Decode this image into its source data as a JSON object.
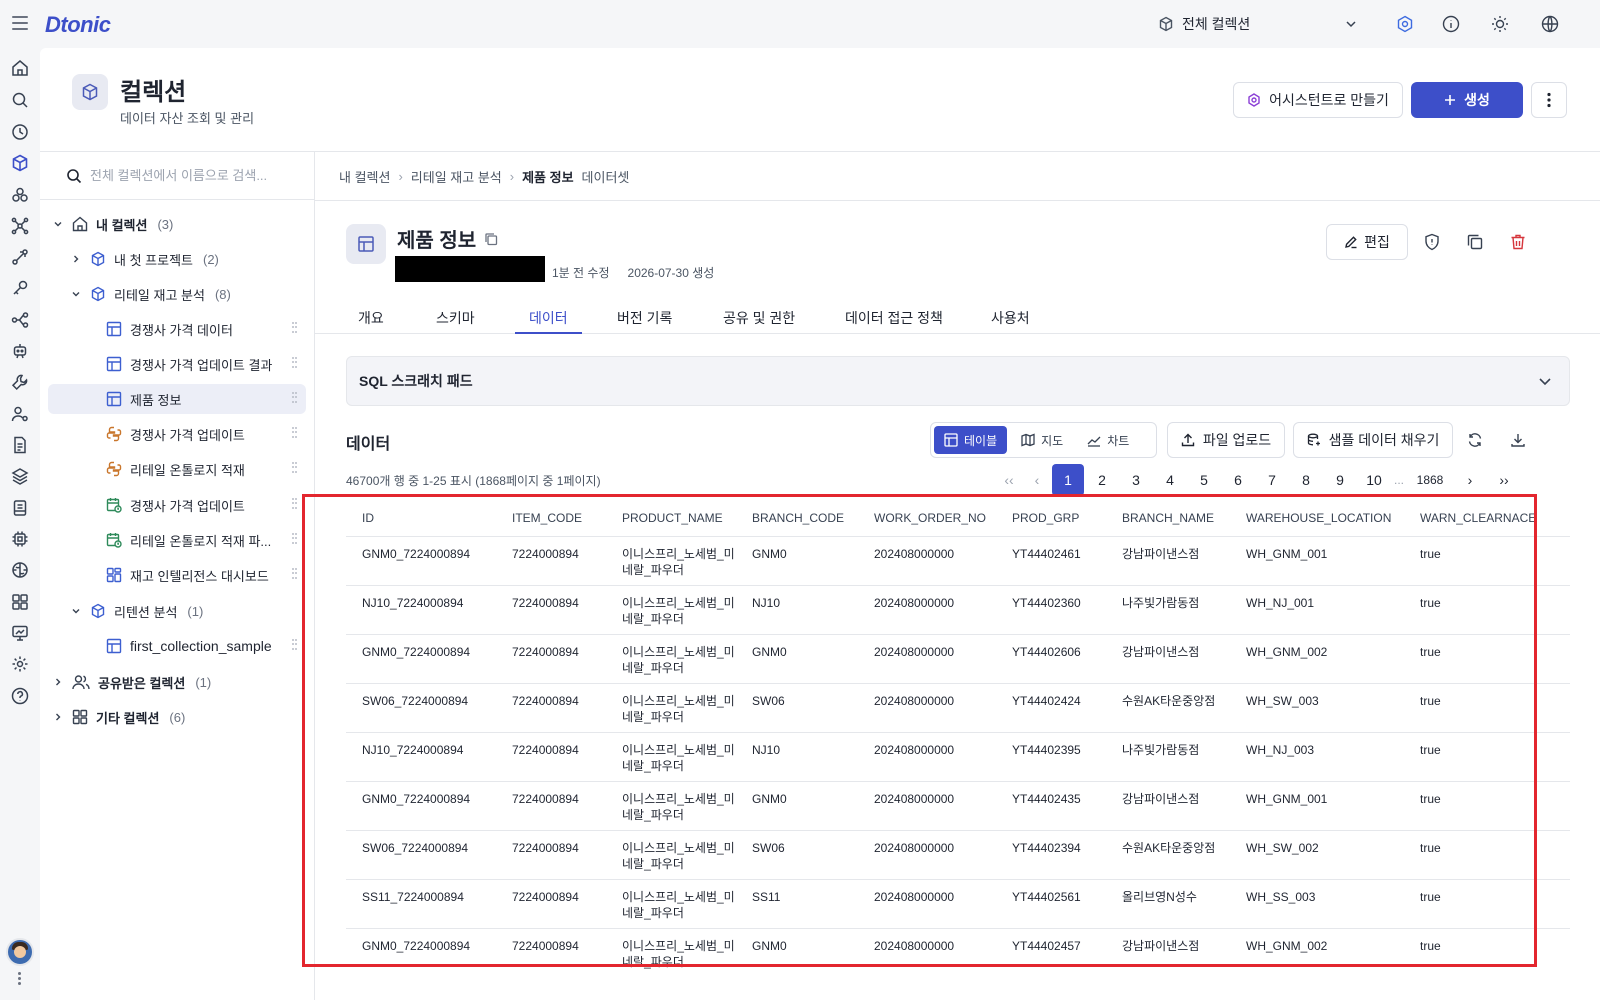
{
  "app": {
    "logo": "Dtonic"
  },
  "topbar": {
    "collection_select": "전체 컬렉션"
  },
  "header": {
    "title": "컬렉션",
    "subtitle": "데이터 자산 조회 및 관리",
    "assist_button": "어시스턴트로 만들기",
    "create_button": "생성"
  },
  "sidebar": {
    "search_placeholder": "전체 컬렉션에서 이름으로 검색...",
    "items": [
      {
        "label": "내 컬렉션",
        "count": "(3)"
      },
      {
        "label": "내 첫 프로젝트",
        "count": "(2)"
      },
      {
        "label": "리테일 재고 분석",
        "count": "(8)"
      },
      {
        "label": "경쟁사 가격 데이터"
      },
      {
        "label": "경쟁사 가격 업데이트 결과"
      },
      {
        "label": "제품 정보"
      },
      {
        "label": "경쟁사 가격 업데이트"
      },
      {
        "label": "리테일 온톨로지 적재"
      },
      {
        "label": "경쟁사 가격 업데이트"
      },
      {
        "label": "리테일 온톨로지 적재 파..."
      },
      {
        "label": "재고 인텔리전스 대시보드"
      },
      {
        "label": "리텐션 분석",
        "count": "(1)"
      },
      {
        "label": "first_collection_sample"
      },
      {
        "label": "공유받은 컬렉션",
        "count": "(1)"
      },
      {
        "label": "기타 컬렉션",
        "count": "(6)"
      }
    ]
  },
  "breadcrumb": {
    "items": [
      "내 컬렉션",
      "리테일 재고 분석",
      "제품 정보"
    ],
    "suffix": "데이터셋"
  },
  "dataset": {
    "title": "제품 정보",
    "modified": "1분 전 수정",
    "created": "2026-07-30 생성",
    "edit_button": "편집"
  },
  "tabs": [
    "개요",
    "스키마",
    "데이터",
    "버전 기록",
    "공유 및 권한",
    "데이터 접근 정책",
    "사용처"
  ],
  "sql_pad": {
    "label": "SQL 스크래치 패드"
  },
  "data_section": {
    "title": "데이터",
    "views": [
      "테이블",
      "지도",
      "차트"
    ],
    "upload_button": "파일 업로드",
    "sample_button": "샘플 데이터 채우기",
    "rows_info": "46700개 행 중 1-25 표시 (1868페이지 중 1페이지)"
  },
  "pagination": {
    "pages": [
      "1",
      "2",
      "3",
      "4",
      "5",
      "6",
      "7",
      "8",
      "9",
      "10"
    ],
    "ellipsis": "...",
    "last": "1868",
    "current": "1"
  },
  "table": {
    "columns": [
      "ID",
      "ITEM_CODE",
      "PRODUCT_NAME",
      "BRANCH_CODE",
      "WORK_ORDER_NO",
      "PROD_GRP",
      "BRANCH_NAME",
      "WAREHOUSE_LOCATION",
      "WARN_CLEARNACE"
    ],
    "rows": [
      [
        "GNM0_7224000894",
        "7224000894",
        "이니스프리_노세범_미네랄_파우더",
        "GNM0",
        "202408000000",
        "YT44402461",
        "강남파이낸스점",
        "WH_GNM_001",
        "true"
      ],
      [
        "NJ10_7224000894",
        "7224000894",
        "이니스프리_노세범_미네랄_파우더",
        "NJ10",
        "202408000000",
        "YT44402360",
        "나주빛가람동점",
        "WH_NJ_001",
        "true"
      ],
      [
        "GNM0_7224000894",
        "7224000894",
        "이니스프리_노세범_미네랄_파우더",
        "GNM0",
        "202408000000",
        "YT44402606",
        "강남파이낸스점",
        "WH_GNM_002",
        "true"
      ],
      [
        "SW06_7224000894",
        "7224000894",
        "이니스프리_노세범_미네랄_파우더",
        "SW06",
        "202408000000",
        "YT44402424",
        "수원AK타운중앙점",
        "WH_SW_003",
        "true"
      ],
      [
        "NJ10_7224000894",
        "7224000894",
        "이니스프리_노세범_미네랄_파우더",
        "NJ10",
        "202408000000",
        "YT44402395",
        "나주빛가람동점",
        "WH_NJ_003",
        "true"
      ],
      [
        "GNM0_7224000894",
        "7224000894",
        "이니스프리_노세범_미네랄_파우더",
        "GNM0",
        "202408000000",
        "YT44402435",
        "강남파이낸스점",
        "WH_GNM_001",
        "true"
      ],
      [
        "SW06_7224000894",
        "7224000894",
        "이니스프리_노세범_미네랄_파우더",
        "SW06",
        "202408000000",
        "YT44402394",
        "수원AK타운중앙점",
        "WH_SW_002",
        "true"
      ],
      [
        "SS11_7224000894",
        "7224000894",
        "이니스프리_노세범_미네랄_파우더",
        "SS11",
        "202408000000",
        "YT44402561",
        "올리브영N성수",
        "WH_SS_003",
        "true"
      ],
      [
        "GNM0_7224000894",
        "7224000894",
        "이니스프리_노세범_미네랄_파우더",
        "GNM0",
        "202408000000",
        "YT44402457",
        "강남파이낸스점",
        "WH_GNM_002",
        "true"
      ]
    ]
  },
  "colors": {
    "accent": "#3d4fc9",
    "highlight": "#e3262e",
    "python_icon": "#c9762c",
    "schedule_icon": "#2e8a5a",
    "delete_icon": "#d6363c"
  }
}
